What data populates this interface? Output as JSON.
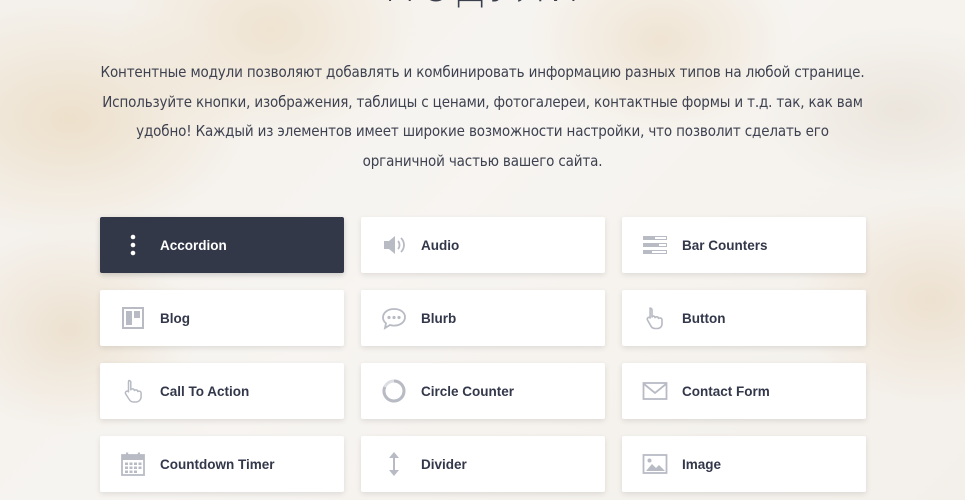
{
  "header": {
    "title": "МОДУЛИ",
    "intro": "Контентные модули позволяют добавлять и комбинировать информацию разных типов на любой странице. Используйте кнопки, изображения, таблицы с ценами, фотогалереи, контактные формы и т.д. так, как вам удобно! Каждый из элементов имеет широкие возможности настройки, что позволит сделать его органичной частью вашего сайта."
  },
  "colors": {
    "active_bg": "#323847",
    "card_bg": "#ffffff",
    "text": "#33374a",
    "icon": "#b8bbc4"
  },
  "modules": [
    {
      "label": "Accordion",
      "icon": "vertical-dots-icon",
      "active": true
    },
    {
      "label": "Audio",
      "icon": "speaker-icon"
    },
    {
      "label": "Bar Counters",
      "icon": "bar-counters-icon"
    },
    {
      "label": "Blog",
      "icon": "blog-icon"
    },
    {
      "label": "Blurb",
      "icon": "speech-bubble-icon"
    },
    {
      "label": "Button",
      "icon": "pointer-hand-icon"
    },
    {
      "label": "Call To Action",
      "icon": "hand-cursor-icon"
    },
    {
      "label": "Circle Counter",
      "icon": "circle-counter-icon"
    },
    {
      "label": "Contact Form",
      "icon": "envelope-icon"
    },
    {
      "label": "Countdown Timer",
      "icon": "calendar-icon"
    },
    {
      "label": "Divider",
      "icon": "vertical-arrows-icon"
    },
    {
      "label": "Image",
      "icon": "image-icon"
    }
  ]
}
